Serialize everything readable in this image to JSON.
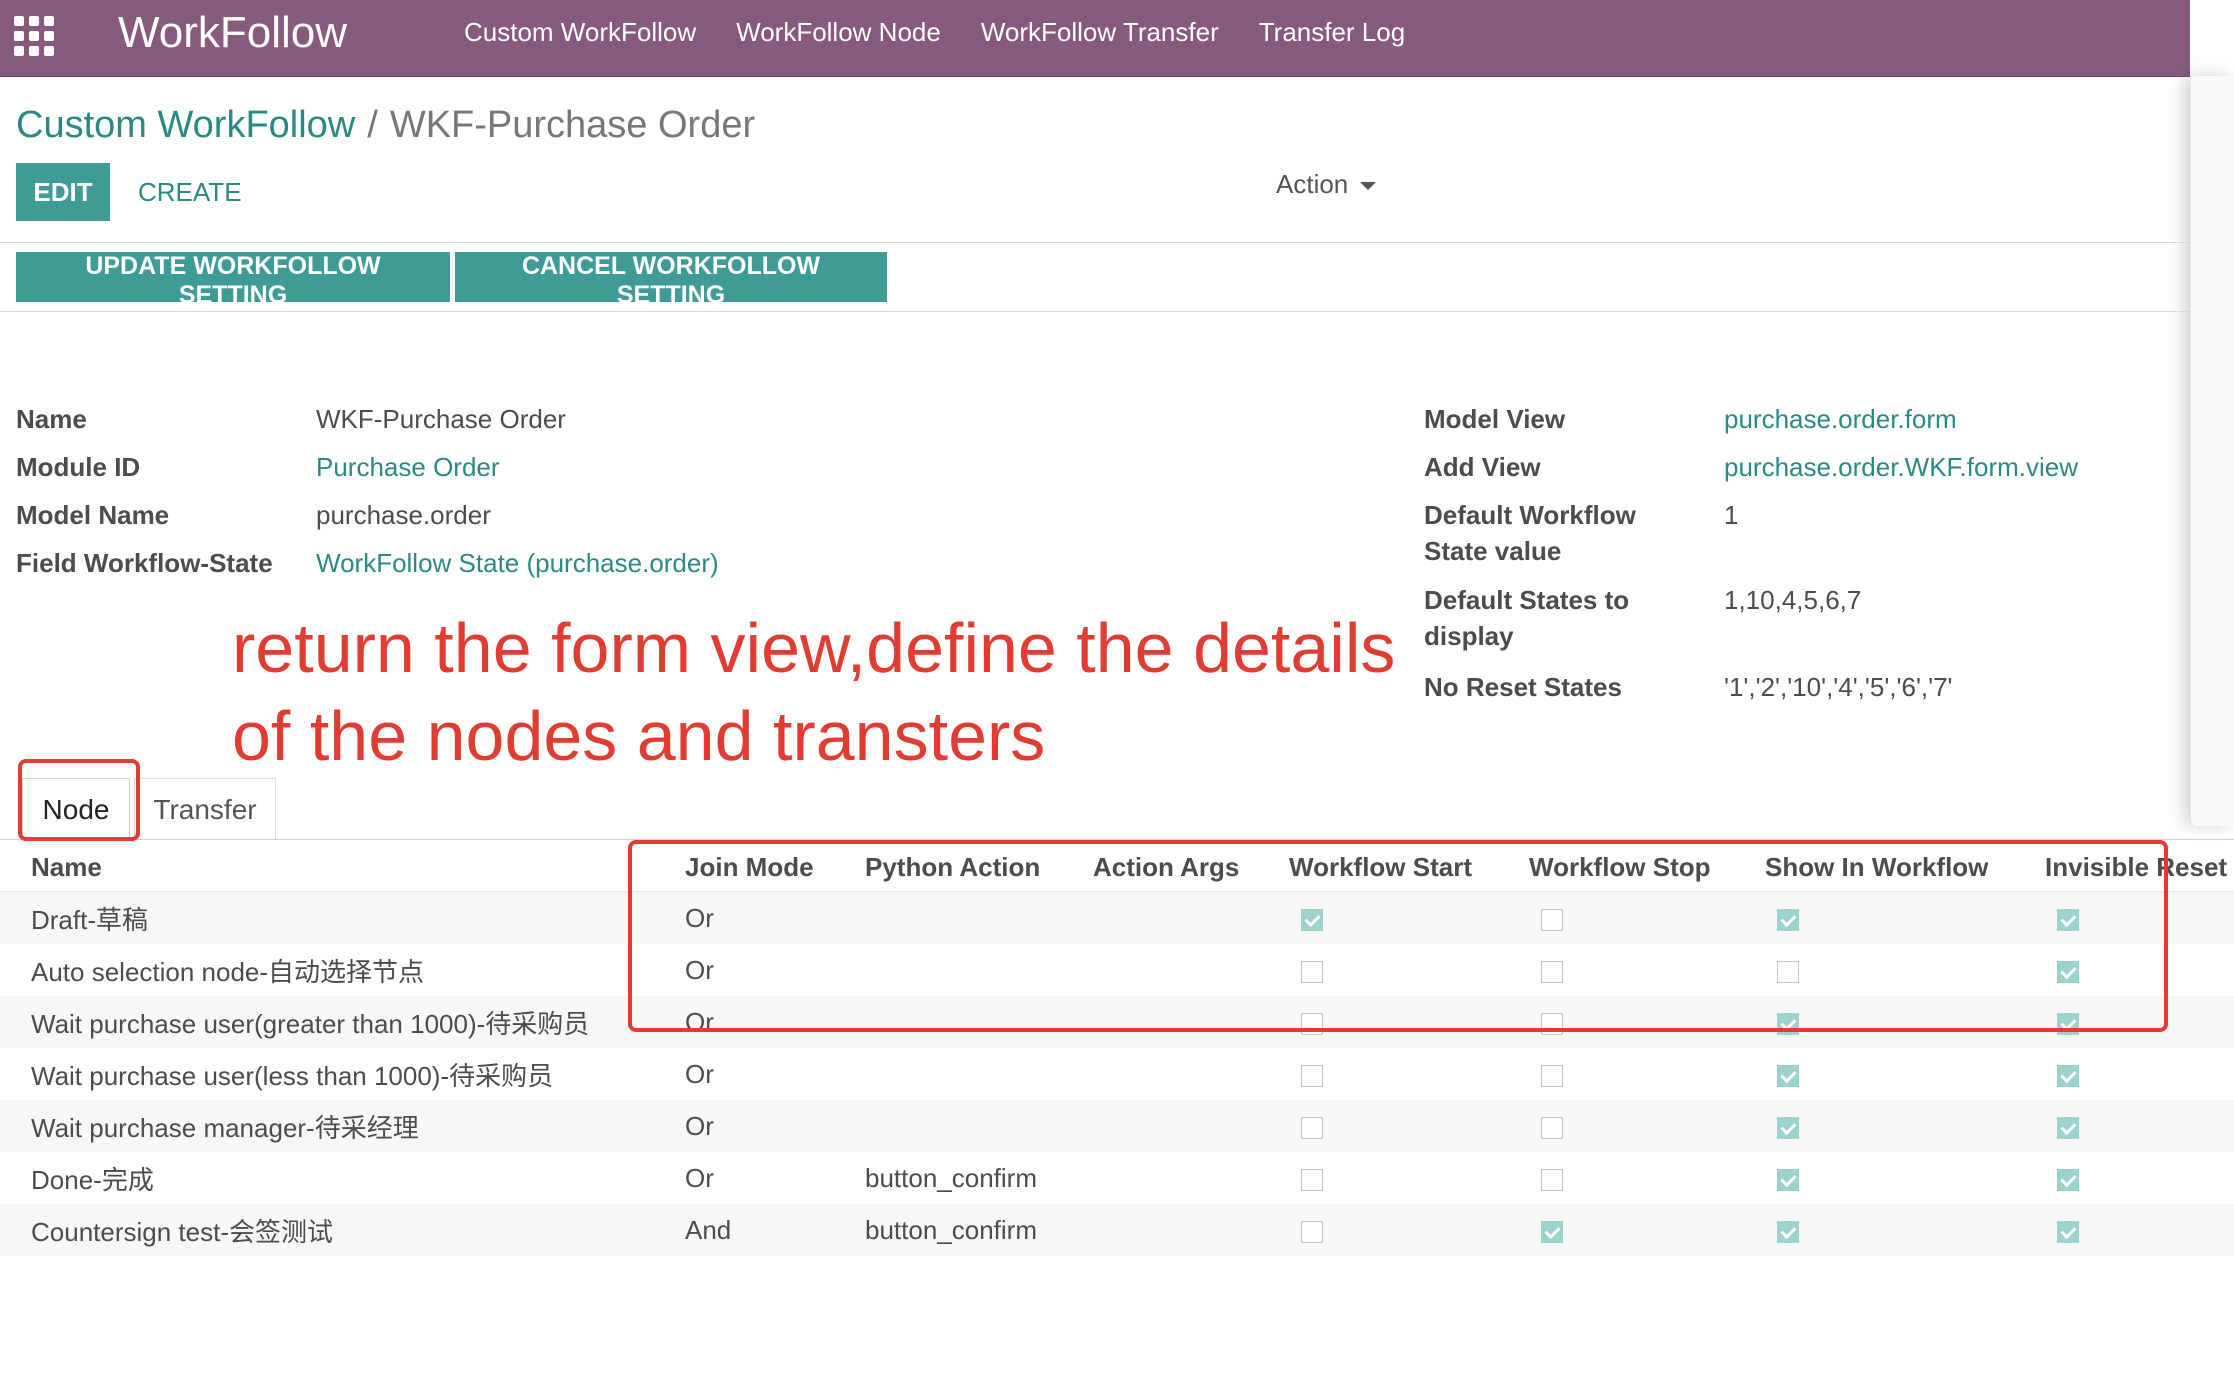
{
  "app": {
    "brand": "WorkFollow",
    "menu": [
      "Custom WorkFollow",
      "WorkFollow Node",
      "WorkFollow Transfer",
      "Transfer Log"
    ]
  },
  "breadcrumb": {
    "parent": "Custom WorkFollow",
    "separator": "/",
    "current": "WKF-Purchase Order"
  },
  "buttons": {
    "edit": "EDIT",
    "create": "CREATE",
    "action": "Action",
    "update_workflow": "UPDATE WORKFOLLOW SETTING",
    "cancel_workflow": "CANCEL WORKFOLLOW SETTING"
  },
  "form": {
    "left": [
      {
        "label": "Name",
        "value": "WKF-Purchase Order",
        "link": false
      },
      {
        "label": "Module ID",
        "value": "Purchase Order",
        "link": true
      },
      {
        "label": "Model Name",
        "value": "purchase.order",
        "link": false
      },
      {
        "label": "Field Workflow-State",
        "value": "WorkFollow State (purchase.order)",
        "link": true
      }
    ],
    "right": [
      {
        "label": "Model View",
        "value": "purchase.order.form",
        "link": true
      },
      {
        "label": "Add View",
        "value": "purchase.order.WKF.form.view",
        "link": true
      },
      {
        "label_line1": "Default Workflow",
        "label_line2": "State value",
        "value": "1"
      },
      {
        "label_line1": "Default States to",
        "label_line2": "display",
        "value": "1,10,4,5,6,7"
      },
      {
        "label": "No Reset States",
        "value": "'1','2','10','4','5','6','7'"
      }
    ]
  },
  "annotation": {
    "line1": "return the  form view,define the details",
    "line2": "of the nodes and transters"
  },
  "tabs": [
    "Node",
    "Transfer"
  ],
  "table": {
    "columns": [
      "Name",
      "Join Mode",
      "Python Action",
      "Action Args",
      "Workflow Start",
      "Workflow Stop",
      "Show In Workflow",
      "Invisible Reset"
    ],
    "rows": [
      {
        "name": "Draft-草稿",
        "join": "Or",
        "python": "",
        "args": "",
        "start": true,
        "stop": false,
        "show": true,
        "reset": true
      },
      {
        "name": "Auto selection node-自动选择节点",
        "join": "Or",
        "python": "",
        "args": "",
        "start": false,
        "stop": false,
        "show": false,
        "reset": true
      },
      {
        "name": "Wait purchase user(greater than 1000)-待采购员",
        "join": "Or",
        "python": "",
        "args": "",
        "start": false,
        "stop": false,
        "show": true,
        "reset": true
      },
      {
        "name": "Wait purchase user(less than 1000)-待采购员",
        "join": "Or",
        "python": "",
        "args": "",
        "start": false,
        "stop": false,
        "show": true,
        "reset": true
      },
      {
        "name": "Wait purchase manager-待采经理",
        "join": "Or",
        "python": "",
        "args": "",
        "start": false,
        "stop": false,
        "show": true,
        "reset": true
      },
      {
        "name": "Done-完成",
        "join": "Or",
        "python": "button_confirm",
        "args": "",
        "start": false,
        "stop": false,
        "show": true,
        "reset": true
      },
      {
        "name": "Countersign test-会签测试",
        "join": "And",
        "python": "button_confirm",
        "args": "",
        "start": false,
        "stop": true,
        "show": true,
        "reset": true
      }
    ]
  },
  "colors": {
    "topbar": "#875a7b",
    "primary": "#3e9b95",
    "link": "#2a8983",
    "annotation": "#e03c31"
  }
}
